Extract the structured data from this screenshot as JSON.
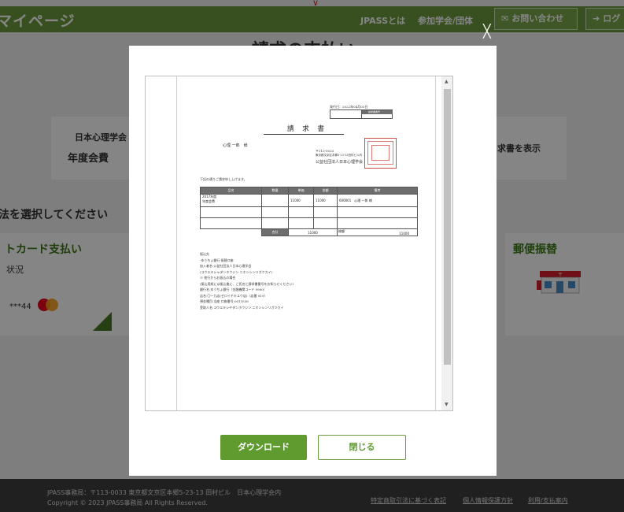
{
  "header": {
    "title": "マイページ",
    "nav_about": "JPASSとは",
    "nav_societies": "参加学会/団体",
    "contact_label": "お問い合わせ",
    "login_label": "ログ"
  },
  "page": {
    "heading": "請求の支払い",
    "society_name": "日本心理学会",
    "fee_label": "年度会費",
    "show_invoice": "求書を表示",
    "choose_method": "法を選択してください",
    "credit_label": "トカード支払い",
    "status_label": "状況",
    "card_number": "***44",
    "postal_label": "郵便振替"
  },
  "modal": {
    "download_label": "ダウンロード",
    "close_label": "閉じる"
  },
  "invoice": {
    "issue_date": "発行日：2022年04月03日",
    "invoice_no_label": "請求書番号",
    "title": "請 求 書",
    "recipient": "心理 一郎　様",
    "postal_code": "〒113-0033",
    "address": "東京都文京区本郷5-23-13田村ビル内",
    "issuer": "公益社団法人日本心理学会",
    "intro": "下記の通りご請求申し上げます。",
    "columns": [
      "品名",
      "数量",
      "単価",
      "金額",
      "備考"
    ],
    "item_line1": "2017年度",
    "item_line2": "年度会費",
    "unit_price": "11000",
    "amount": "11000",
    "member_id": "600001",
    "member_name": "心理 一郎 様",
    "subtotal_label": "合計",
    "subtotal": "11000",
    "total_label": "総額",
    "total": "11000",
    "payee_lines": [
      "振込先",
      "-ゆうちょ銀行 振替口座",
      "加入者名:公益社団法人日本心理学会",
      "(コウエキシャダンホウジン ニホンシンリガクカイ)",
      "※ 他行からお振込の場合",
      "(振込用紙には振込後に、ご氏名と請求書番号をお知らせください)",
      "銀行名:ゆうちょ銀行（金融機関コード 9900）",
      "店名:〇一九店(ゼロイチキユウ店)（店番 019）",
      "預金種目:当座  口座番号:0013536",
      "受取人名:コウエキシヤダンホウジン ニホンシンリガツカイ"
    ]
  },
  "footer": {
    "address_line": "JPASS事務局：〒113-0033 東京都文京区本郷5-23-13 田村ビル　日本心理学会内",
    "copyright": "Copyright © 2023 JPASS事務局 All Rights Reserved.",
    "link_commerce": "特定商取引法に基づく表記",
    "link_privacy": "個人情報保護方針",
    "link_terms": "利用/支払案内"
  },
  "colors": {
    "brand_green": "#6c9a3c",
    "button_green": "#5f9b2f",
    "footer_bg": "#3e3e3e"
  },
  "icons": {
    "mail": "mail-icon",
    "login": "login-icon",
    "close": "close-icon",
    "card_brand": "mastercard-icon",
    "post_office": "post-office-icon"
  }
}
